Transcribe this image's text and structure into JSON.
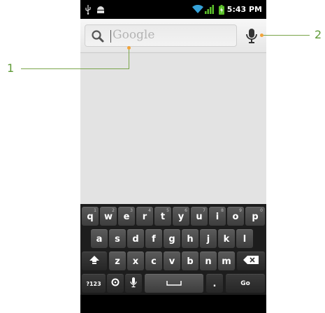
{
  "status": {
    "time": "5:43 PM",
    "icons": [
      "usb-icon",
      "android-debug-icon",
      "wifi-icon",
      "signal-icon",
      "battery-icon"
    ]
  },
  "search": {
    "placeholder": "Google"
  },
  "keyboard": {
    "row1": [
      {
        "key": "q",
        "hint": "1"
      },
      {
        "key": "w",
        "hint": "2"
      },
      {
        "key": "e",
        "hint": "3"
      },
      {
        "key": "r",
        "hint": "4"
      },
      {
        "key": "t",
        "hint": "5"
      },
      {
        "key": "y",
        "hint": "6"
      },
      {
        "key": "u",
        "hint": "7"
      },
      {
        "key": "i",
        "hint": "8"
      },
      {
        "key": "o",
        "hint": "9"
      },
      {
        "key": "p",
        "hint": "0"
      }
    ],
    "row2": [
      "a",
      "s",
      "d",
      "f",
      "g",
      "h",
      "j",
      "k",
      "l"
    ],
    "row3": [
      "z",
      "x",
      "c",
      "v",
      "b",
      "n",
      "m"
    ],
    "symbols_key": "?123",
    "period_key": ".",
    "go_key": "Go"
  },
  "callouts": [
    {
      "number": "1",
      "target": "search-input"
    },
    {
      "number": "2",
      "target": "voice-search-button"
    }
  ],
  "colors": {
    "callout_line": "#7aa54a",
    "callout_text": "#5f9a37",
    "callout_dot": "#f2a33a",
    "status_bar": "#000000",
    "background": "#e3e3e3",
    "keyboard": "#1d1d1d"
  }
}
